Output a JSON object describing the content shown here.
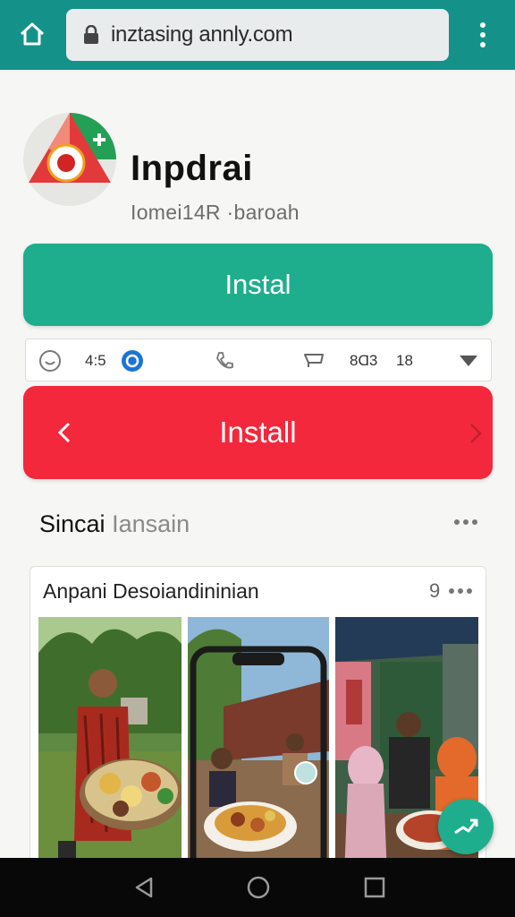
{
  "browser": {
    "url": "inztasing annly.com",
    "icons": [
      "home-icon",
      "lock-icon",
      "more-vertical-icon"
    ]
  },
  "app": {
    "name": "Inpdrai",
    "meta": "Iomei14R ·baroah",
    "logo": "app-logo"
  },
  "buttons": {
    "install_primary": "Instal",
    "install_secondary": "Install"
  },
  "info_bar": {
    "rating": "4:5",
    "size": "8Ɑ3",
    "count": "18",
    "icons": [
      "smile-icon",
      "verified-badge-icon",
      "phone-icon",
      "cart-icon",
      "dropdown-arrow-icon"
    ]
  },
  "section": {
    "title": "Sincai",
    "title_faded": "Iansain"
  },
  "card": {
    "title": "Anpani Desoiandininian",
    "count": "9"
  },
  "colors": {
    "topbar": "#14928a",
    "install_green": "#1fae8d",
    "install_red": "#f3283c",
    "navbar": "#080808"
  },
  "navigation": {
    "icons": [
      "back-icon",
      "home-circle-icon",
      "recents-icon"
    ]
  }
}
